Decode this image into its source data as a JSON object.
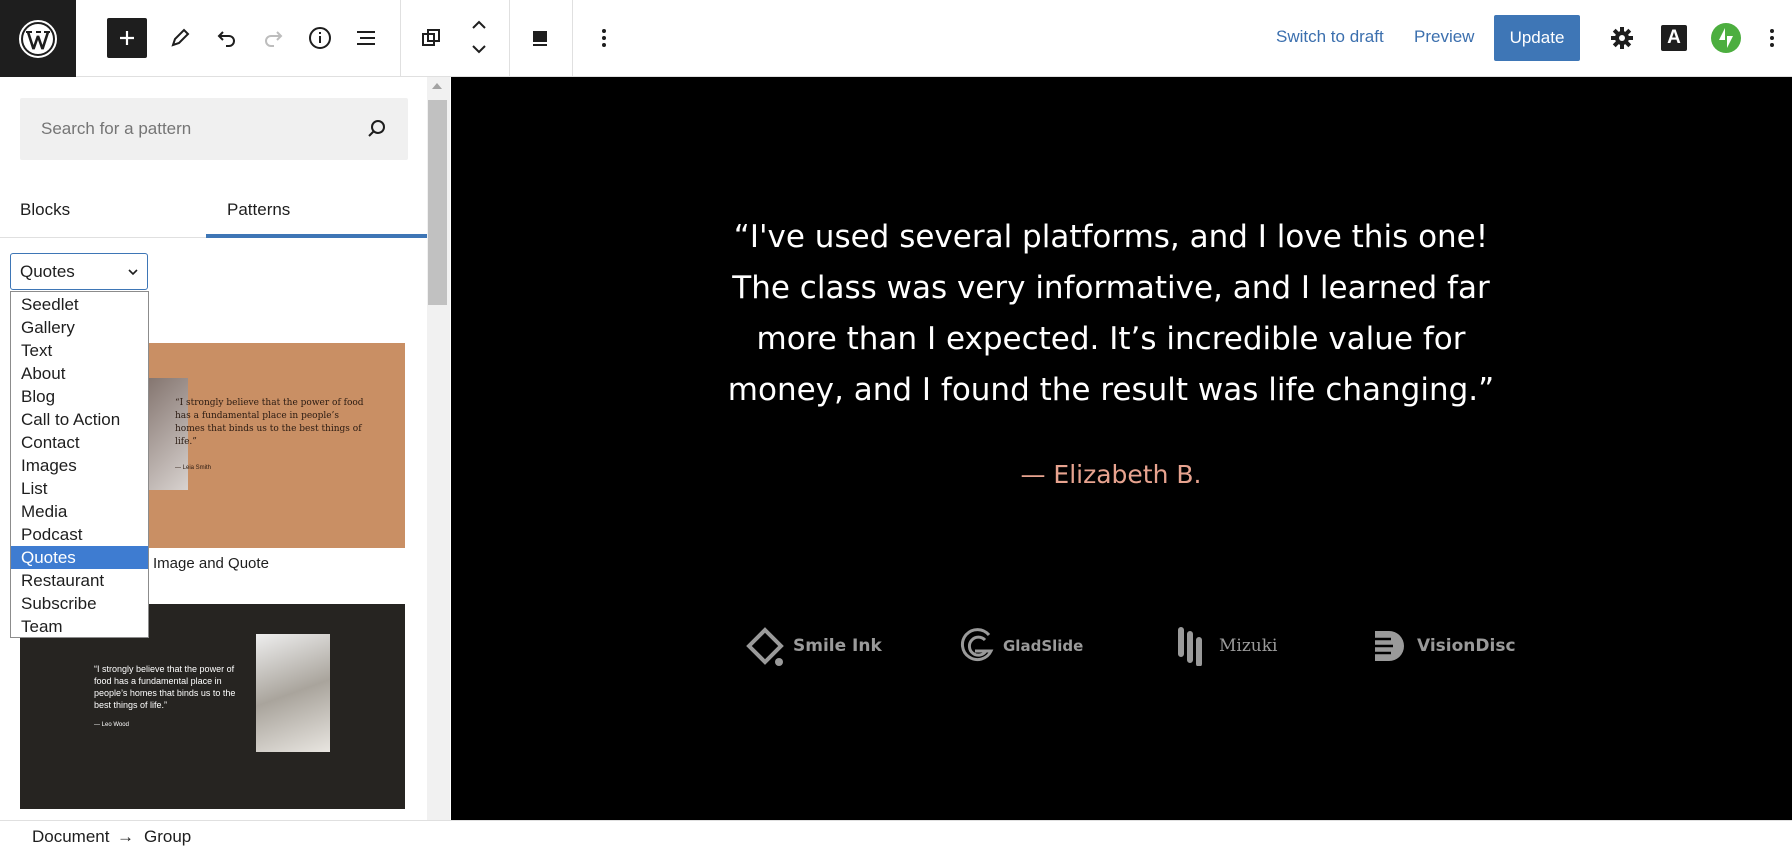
{
  "toolbar": {
    "switch_to_draft": "Switch to draft",
    "preview": "Preview",
    "update": "Update",
    "font_button_label": "A"
  },
  "sidebar": {
    "search": {
      "placeholder": "Search for a pattern"
    },
    "tabs": [
      "Blocks",
      "Patterns"
    ],
    "active_tab": "Patterns",
    "category_select": {
      "value": "Quotes",
      "options": [
        "Seedlet",
        "Gallery",
        "Text",
        "About",
        "Blog",
        "Call to Action",
        "Contact",
        "Images",
        "List",
        "Media",
        "Podcast",
        "Quotes",
        "Restaurant",
        "Subscribe",
        "Team"
      ]
    },
    "patterns": [
      {
        "caption": "Image and Quote",
        "quote": "“I strongly believe that the power of food has a fundamental place in people’s homes that binds us to the best things of life.”",
        "attribution": "— Leia Smith"
      },
      {
        "caption": "",
        "quote": "“I strongly believe that the power of food has a fundamental place in people’s homes that binds us to the best things of life.”",
        "attribution": "— Leo Wood"
      }
    ]
  },
  "canvas": {
    "quote": "“I've used several platforms, and I love this one! The class was very informative, and I learned far more than I expected. It’s incredible value for money, and I found the result was life changing.”",
    "citation": "— Elizabeth B.",
    "logos": [
      "Smile Ink",
      "GladSlide",
      "Mizuki",
      "VisionDisc"
    ]
  },
  "footer": {
    "breadcrumb": [
      "Document",
      "Group"
    ],
    "separator": "→"
  },
  "colors": {
    "accent": "#3e76b6",
    "canvas_bg": "#000000",
    "citation": "#e7a38f",
    "dropdown_selected": "#3e7cd1"
  }
}
